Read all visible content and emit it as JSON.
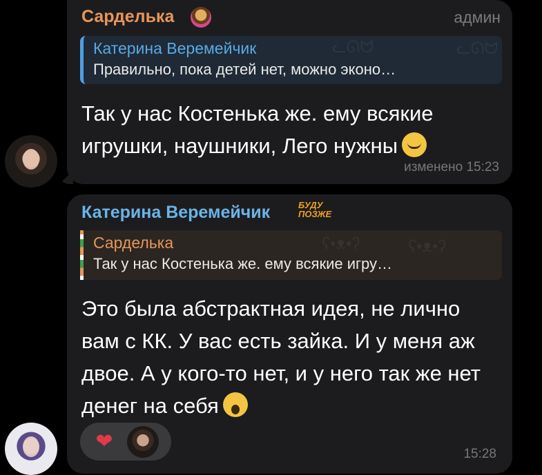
{
  "messages": [
    {
      "sender": "Сарделька",
      "role": "админ",
      "reply": {
        "name": "Катерина Веремейчик",
        "text": "Правильно, пока детей нет, можно эконо…"
      },
      "text": "Так у нас Костенька же. ему всякие игрушки, наушники, Лего нужны",
      "meta": "изменено 15:23",
      "emoji": "sweat-smile-emoji"
    },
    {
      "sender": "Катерина Веремейчик",
      "badge": "БУДУ ПОЗЖЕ",
      "reply": {
        "name": "Сарделька",
        "text": "Так у нас Костенька же. ему всякие игру…"
      },
      "text": "Это была абстрактная идея, не лично вам с КК. У вас есть зайка. И у меня аж двое. А у кого-то нет, и у него так же нет денег на себя",
      "meta": "15:28",
      "emoji": "crying-emoji",
      "reactions": [
        "heart-on-fire-icon",
        "avatar"
      ]
    }
  ],
  "colors": {
    "background": "#000000",
    "bubble": "#1c1c1e",
    "sender1": "#e8965a",
    "sender2": "#6ab4e8",
    "meta": "#77777c"
  }
}
